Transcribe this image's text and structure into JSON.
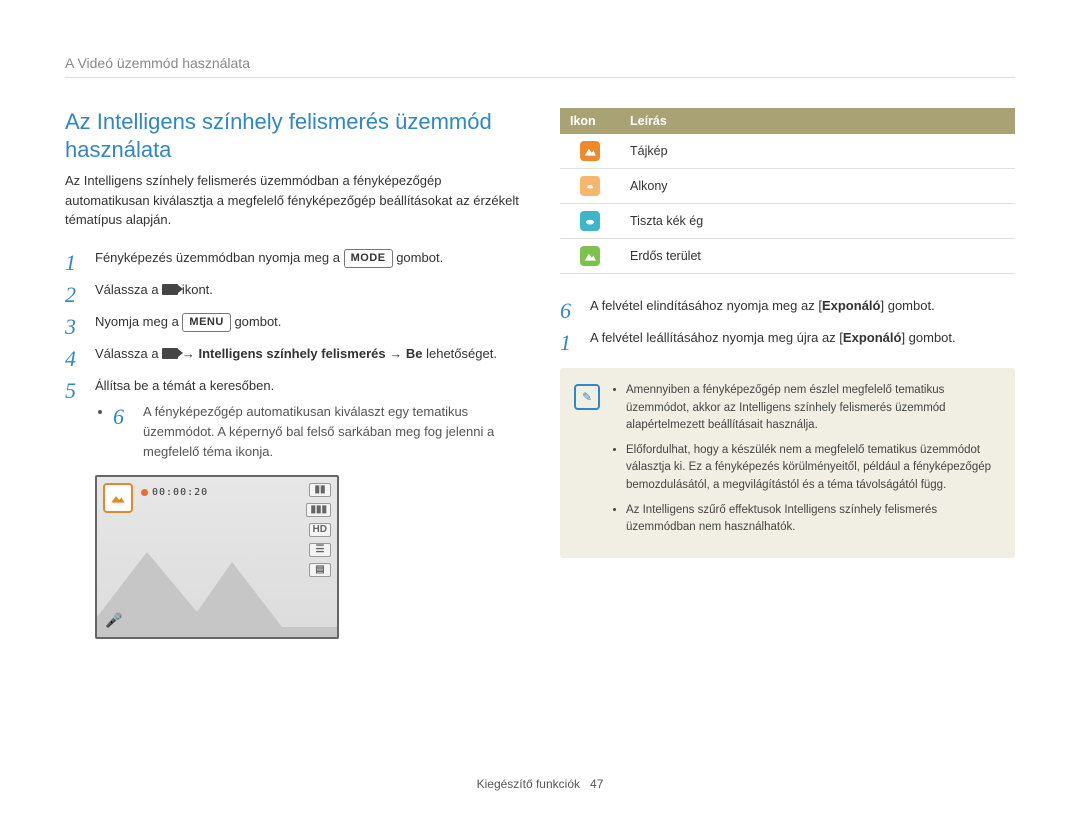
{
  "breadcrumb": "A Videó üzemmód használata",
  "title": "Az Intelligens színhely felismerés üzemmód használata",
  "intro": "Az Intelligens színhely felismerés üzemmódban a fényképezőgép automatikusan kiválasztja a megfelelő fényképezőgép beállításokat az érzékelt tématípus alapján.",
  "steps": {
    "s1a": "Fényképezés üzemmódban nyomja meg a ",
    "s1b": " gombot.",
    "s2a": "Válassza a ",
    "s2b": " ikont.",
    "s3a": "Nyomja meg a ",
    "s3b": " gombot.",
    "s4a": "Válassza a ",
    "s4b": " → ",
    "s4_bold1": "Intelligens színhely felismerés",
    "s4c": " → ",
    "s4_bold2": "Be",
    "s4d": " lehetőséget.",
    "s5": "Állítsa be a témát a keresőben.",
    "s5_sub": "A fényképezőgép automatikusan kiválaszt egy tematikus üzemmódot. A képernyő bal felső sarkában meg fog jelenni a megfelelő téma ikonja.",
    "s6a": "A felvétel elindításához nyomja meg az [",
    "s6_bold": "Exponáló",
    "s6b": "] gombot.",
    "s7a": "A felvétel leállításához nyomja meg újra az [",
    "s7_bold": "Exponáló",
    "s7b": "] gombot."
  },
  "keys": {
    "mode": "MODE",
    "menu": "MENU"
  },
  "preview": {
    "timer": "00:00:20",
    "badges": [
      "▮▮",
      "▮▮▮",
      "HD",
      "☰",
      "▤"
    ]
  },
  "table": {
    "head_icon": "Ikon",
    "head_desc": "Leírás",
    "rows": [
      {
        "desc": "Tájkép"
      },
      {
        "desc": "Alkony"
      },
      {
        "desc": "Tiszta kék ég"
      },
      {
        "desc": "Erdős terület"
      }
    ]
  },
  "notes": [
    "Amennyiben a fényképezőgép nem észlel megfelelő tematikus üzemmódot, akkor az Intelligens színhely felismerés üzemmód alapértelmezett beállításait használja.",
    "Előfordulhat, hogy a készülék nem a megfelelő tematikus üzemmódot választja ki. Ez a fényképezés körülményeitől, például a fényképezőgép bemozdulásától, a megvilágítástól és a téma távolságától függ.",
    "Az Intelligens szűrő effektusok Intelligens színhely felismerés üzemmódban nem használhatók."
  ],
  "footer": {
    "label": "Kiegészítő funkciók",
    "page": "47"
  }
}
